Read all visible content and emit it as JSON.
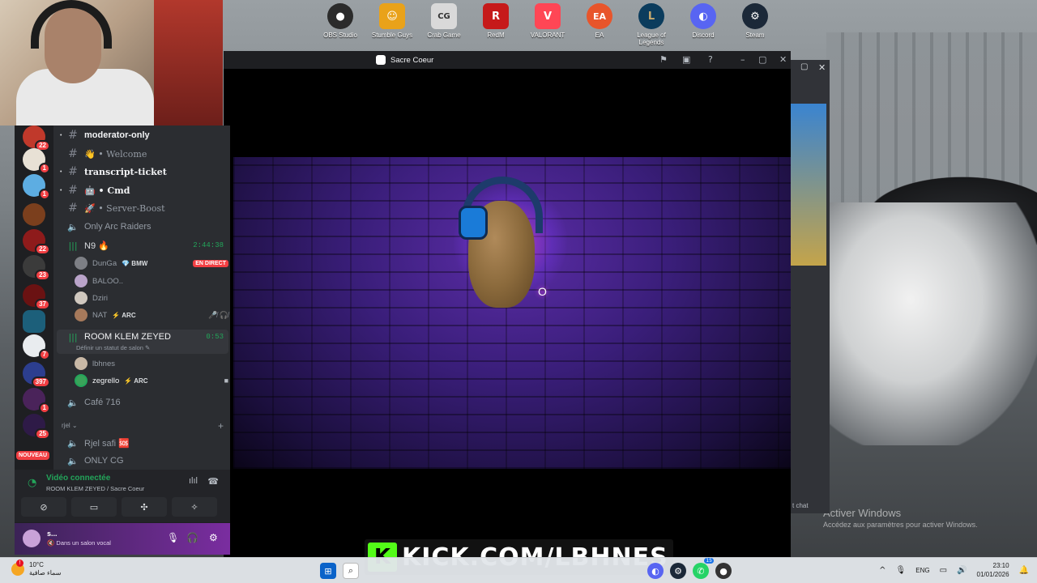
{
  "desktop": {
    "icons": [
      {
        "label": "OBS Studio",
        "icon": "obs-icon",
        "color": "#2b2b2b",
        "glyph": "●"
      },
      {
        "label": "Stumble Guys",
        "icon": "stumble-guys-icon",
        "color": "#e9a21a",
        "glyph": "☺"
      },
      {
        "label": "Crab Game",
        "icon": "crab-game-icon",
        "color": "#d9d9d9",
        "glyph": "CG"
      },
      {
        "label": "RedM",
        "icon": "redm-icon",
        "color": "#c61a1a",
        "glyph": "R"
      },
      {
        "label": "VALORANT",
        "icon": "valorant-icon",
        "color": "#ff4655",
        "glyph": "V"
      },
      {
        "label": "EA",
        "icon": "ea-icon",
        "color": "#e8552b",
        "glyph": "EA"
      },
      {
        "label": "League of Legends",
        "icon": "league-of-legends-icon",
        "color": "#0b3c5d",
        "glyph": "L"
      },
      {
        "label": "Discord",
        "icon": "discord-icon",
        "color": "#5865f2",
        "glyph": "◐"
      },
      {
        "label": "Steam",
        "icon": "steam-icon",
        "color": "#1b2838",
        "glyph": "⚙"
      }
    ],
    "activation": {
      "title": "Activer Windows",
      "subtitle": "Accédez aux paramètres pour activer Windows."
    }
  },
  "discord": {
    "servers": [
      {
        "badge": "22",
        "color": "#c0392b"
      },
      {
        "badge": "1",
        "color": "#e8e1d5"
      },
      {
        "badge": "1",
        "color": "#5dade2"
      },
      {
        "badge": "",
        "color": "#7b3f1d"
      },
      {
        "badge": "22",
        "color": "#8e1b1b"
      },
      {
        "badge": "23",
        "color": "#3b3b3b"
      },
      {
        "badge": "37",
        "color": "#6a1212"
      },
      {
        "badge": "",
        "color": "#1c5f7a"
      },
      {
        "badge": "7",
        "color": "#e9ecef"
      },
      {
        "badge": "397",
        "color": "#2c3e8f"
      },
      {
        "badge": "1",
        "color": "#4a235a"
      },
      {
        "badge": "25",
        "color": "#2e1a47"
      }
    ],
    "new_label": "NOUVEAU",
    "channels": {
      "moderator": "moderator-only",
      "welcome": "👋 • Welcome",
      "transcript": "transcript-ticket",
      "cmd": "🤖 • Cmd",
      "boost": "🚀 • Server-Boost",
      "arc_raiders": "Only Arc Raiders",
      "n9": "N9 🔥",
      "n9_timer": "2:44:38",
      "room": "ROOM KLEM ZEYED",
      "room_timer": "0:53",
      "room_status": "Définir un statut de salon ✎",
      "cafe": "Café 716",
      "category": "rjel ⌄",
      "rjel_safi": "Rjel safi 🆘",
      "only_cg": "ONLY CG"
    },
    "n9_users": [
      {
        "name": "DunGa",
        "tag": "💎 BMW",
        "live": "EN DIRECT"
      },
      {
        "name": "BALOO..",
        "tag": "",
        "live": ""
      },
      {
        "name": "Dziri",
        "tag": "",
        "live": ""
      },
      {
        "name": "NAT",
        "tag": "ARC",
        "live": ""
      }
    ],
    "room_users": [
      {
        "name": "lbhnes",
        "tag": ""
      },
      {
        "name": "zegrello",
        "tag": "ARC"
      }
    ],
    "voice": {
      "status": "Vidéo connectée",
      "location": "ROOM KLEM ZEYED / Sacre Coeur"
    },
    "user": {
      "name": "s...",
      "status": "🔇 Dans un salon vocal"
    }
  },
  "stream_window": {
    "title": "Sacre Coeur",
    "logo_letter": "O"
  },
  "side_window": {
    "chat_label": "t chat"
  },
  "banner": {
    "text": "KICK.COM/LBHNES",
    "k": "K"
  },
  "taskbar": {
    "weather_temp": "10°C",
    "weather_desc": "سماء صافية",
    "alert": "!",
    "lang": "ENG",
    "time": "23:10",
    "date": "01/01/2026",
    "tray_badge": "15"
  }
}
